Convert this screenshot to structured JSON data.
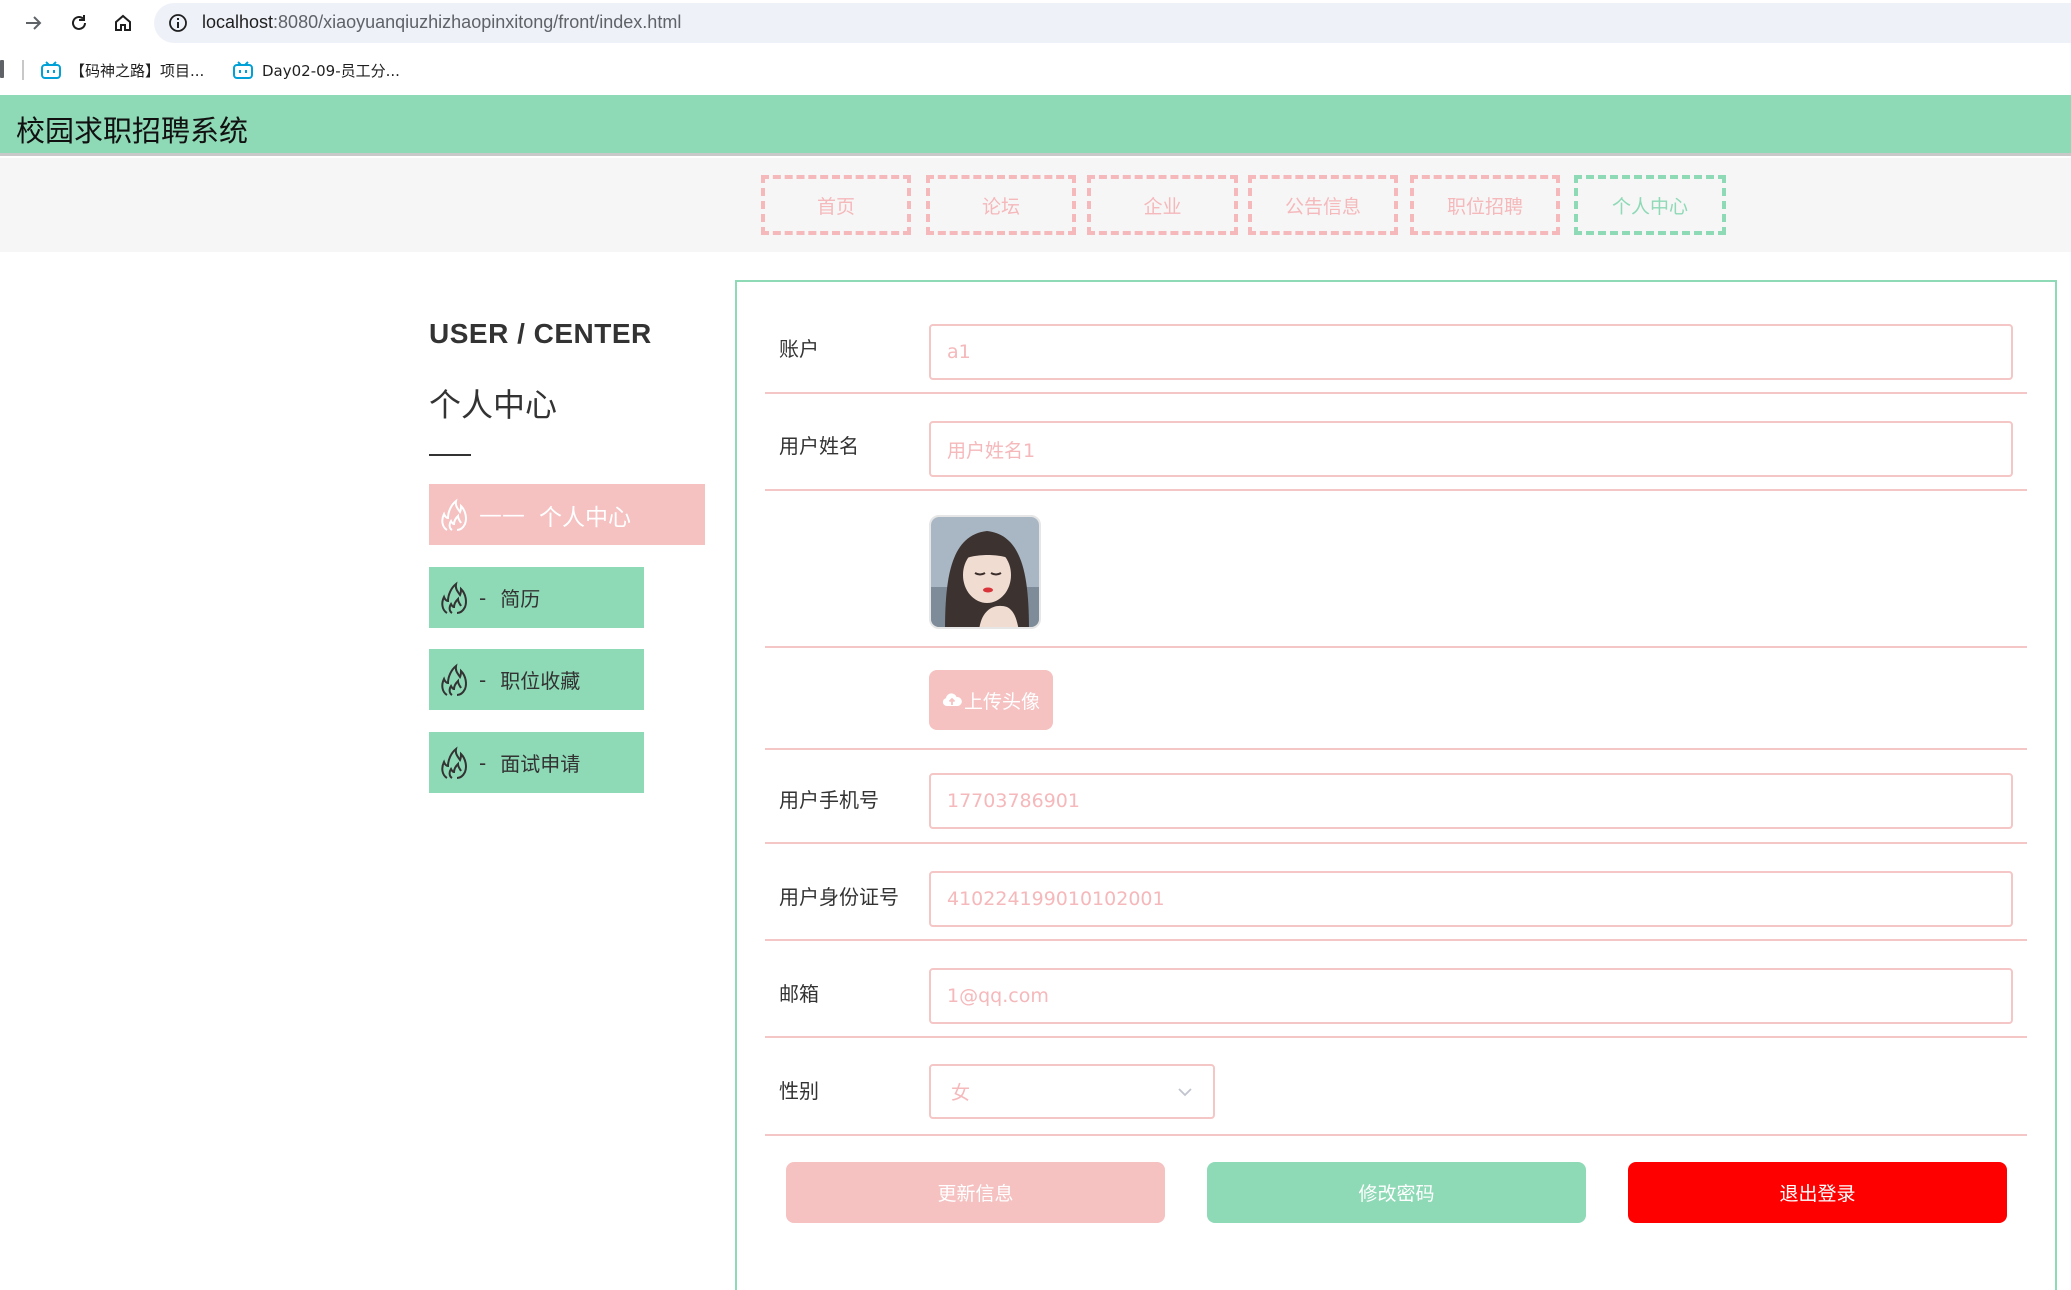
{
  "browser": {
    "url_host": "localhost",
    "url_path": ":8080/xiaoyuanqiuzhizhaopinxitong/front/index.html",
    "bookmarks": [
      {
        "label": "【码神之路】项目..."
      },
      {
        "label": "Day02-09-员工分..."
      }
    ]
  },
  "site": {
    "title": "校园求职招聘系统",
    "nav": [
      {
        "label": "首页",
        "active": false
      },
      {
        "label": "论坛",
        "active": false
      },
      {
        "label": "企业",
        "active": false
      },
      {
        "label": "公告信息",
        "active": false
      },
      {
        "label": "职位招聘",
        "active": false
      },
      {
        "label": "个人中心",
        "active": true
      }
    ]
  },
  "sidebar": {
    "title_en": "USER / CENTER",
    "title_cn": "个人中心",
    "items": [
      {
        "label": "个人中心",
        "prefix": "——",
        "active": true
      },
      {
        "label": "简历",
        "prefix": "-",
        "active": false
      },
      {
        "label": "职位收藏",
        "prefix": "-",
        "active": false
      },
      {
        "label": "面试申请",
        "prefix": "-",
        "active": false
      }
    ]
  },
  "form": {
    "account": {
      "label": "账户",
      "value": "a1"
    },
    "username": {
      "label": "用户姓名",
      "value": "用户姓名1"
    },
    "upload_label": "上传头像",
    "phone": {
      "label": "用户手机号",
      "value": "17703786901"
    },
    "id_card": {
      "label": "用户身份证号",
      "value": "410224199010102001"
    },
    "email": {
      "label": "邮箱",
      "value": "1@qq.com"
    },
    "gender": {
      "label": "性别",
      "value": "女"
    },
    "buttons": {
      "update": "更新信息",
      "change_password": "修改密码",
      "logout": "退出登录"
    }
  },
  "colors": {
    "brand_green": "#8ed9b6",
    "brand_pink": "#f5c1c1",
    "logout_red": "#ff0000"
  }
}
